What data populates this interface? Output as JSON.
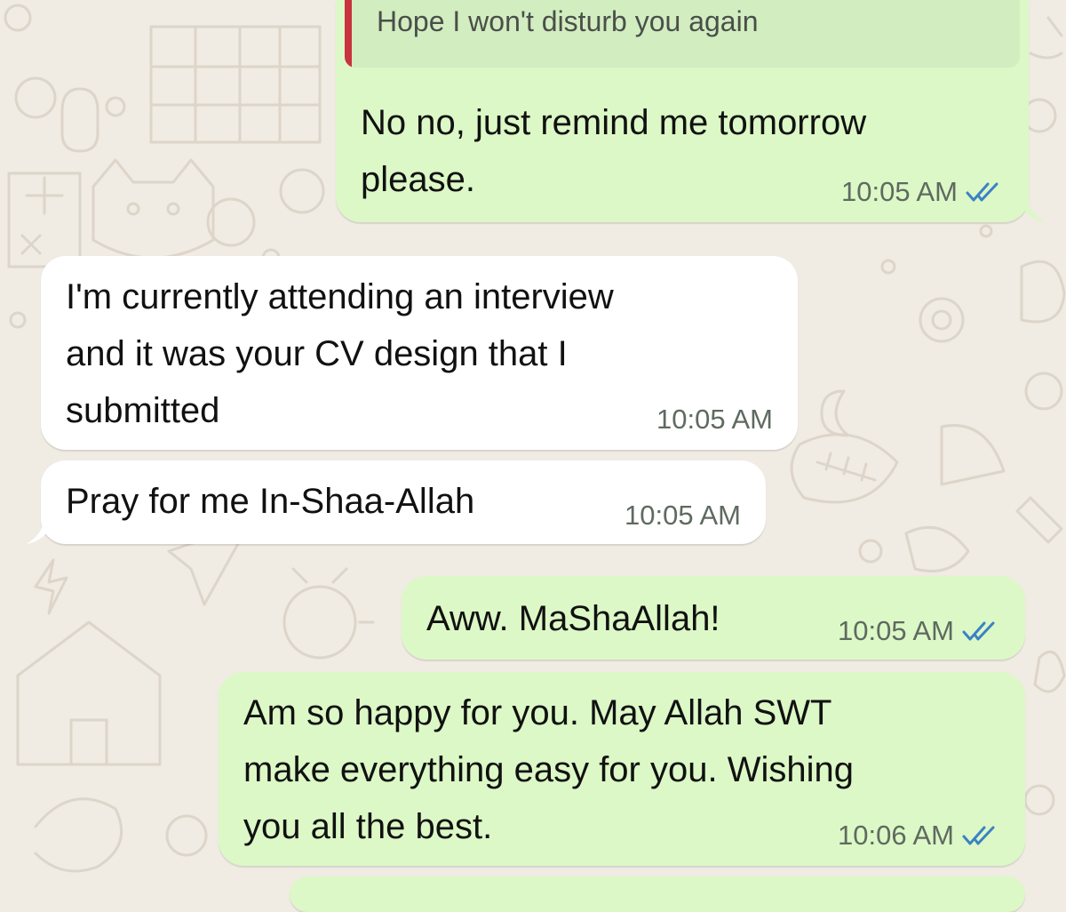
{
  "colors": {
    "wallpaper": "#f0ebe3",
    "outgoing_bubble": "#dcf8c6",
    "incoming_bubble": "#ffffff",
    "reply_accent": "#c8333d",
    "read_ticks": "#3b82c4",
    "timestamp": "#5f6a60"
  },
  "icons": {
    "read_receipt": "double-check-icon"
  },
  "messages": [
    {
      "direction": "outgoing",
      "quoted": "Hope I won't disturb you again",
      "text": "No no, just remind me tomorrow\nplease.",
      "time": "10:05 AM",
      "status": "read"
    },
    {
      "direction": "incoming",
      "text": "I'm currently attending an interview\nand it was your CV design that I\nsubmitted",
      "time": "10:05 AM"
    },
    {
      "direction": "incoming",
      "text": "Pray for me In-Shaa-Allah",
      "time": "10:05 AM"
    },
    {
      "direction": "outgoing",
      "text": "Aww. MaShaAllah!",
      "time": "10:05 AM",
      "status": "read"
    },
    {
      "direction": "outgoing",
      "text": "Am so happy for you. May Allah SWT\nmake everything easy for you. Wishing\nyou all the best.",
      "time": "10:06 AM",
      "status": "read"
    }
  ]
}
